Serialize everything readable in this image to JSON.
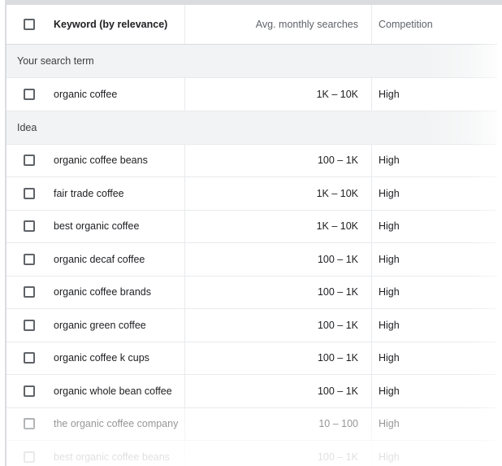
{
  "header": {
    "keyword_label": "Keyword (by relevance)",
    "searches_label": "Avg. monthly searches",
    "competition_label": "Competition"
  },
  "groups": {
    "search_term_label": "Your search term",
    "idea_label": "Idea"
  },
  "search_term_rows": [
    {
      "keyword": "organic coffee",
      "searches": "1K – 10K",
      "competition": "High"
    }
  ],
  "idea_rows": [
    {
      "keyword": "organic coffee beans",
      "searches": "100 – 1K",
      "competition": "High"
    },
    {
      "keyword": "fair trade coffee",
      "searches": "1K – 10K",
      "competition": "High"
    },
    {
      "keyword": "best organic coffee",
      "searches": "1K – 10K",
      "competition": "High"
    },
    {
      "keyword": "organic decaf coffee",
      "searches": "100 – 1K",
      "competition": "High"
    },
    {
      "keyword": "organic coffee brands",
      "searches": "100 – 1K",
      "competition": "High"
    },
    {
      "keyword": "organic green coffee",
      "searches": "100 – 1K",
      "competition": "High"
    },
    {
      "keyword": "organic coffee k cups",
      "searches": "100 – 1K",
      "competition": "High"
    },
    {
      "keyword": "organic whole bean coffee",
      "searches": "100 – 1K",
      "competition": "High"
    },
    {
      "keyword": "the organic coffee company",
      "searches": "10 – 100",
      "competition": "High"
    },
    {
      "keyword": "best organic coffee beans",
      "searches": "100 – 1K",
      "competition": "High"
    }
  ],
  "colors": {
    "border": "#dadce0",
    "group_background": "#f1f3f4",
    "checkbox_border": "#5f6368"
  }
}
